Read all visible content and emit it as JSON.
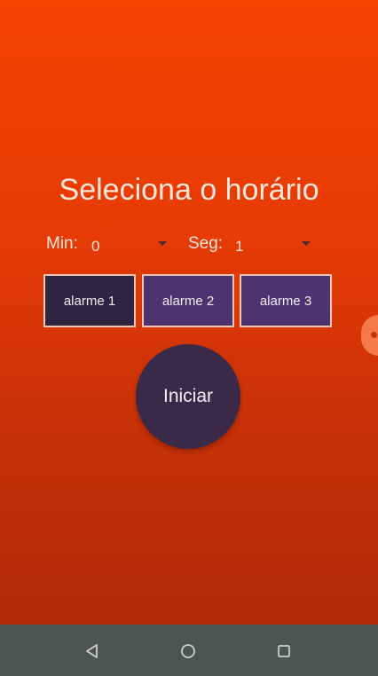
{
  "header": {
    "title": "Seleciona o horário"
  },
  "timer": {
    "min_label": "Min:",
    "min_value": "0",
    "seg_label": "Seg:",
    "seg_value": "1"
  },
  "alarms": [
    {
      "label": "alarme 1",
      "color": "#2f2540"
    },
    {
      "label": "alarme 2",
      "color": "#4d3470"
    },
    {
      "label": "alarme 3",
      "color": "#4d3470"
    }
  ],
  "start_button": {
    "label": "Iniciar"
  },
  "navigation": {
    "icons": [
      "back-icon",
      "home-icon",
      "recents-icon"
    ]
  },
  "colors": {
    "background_top": "#f54300",
    "background_bottom": "#a92908",
    "button_dark": "#3a2a48",
    "navbar": "#4c5554"
  }
}
